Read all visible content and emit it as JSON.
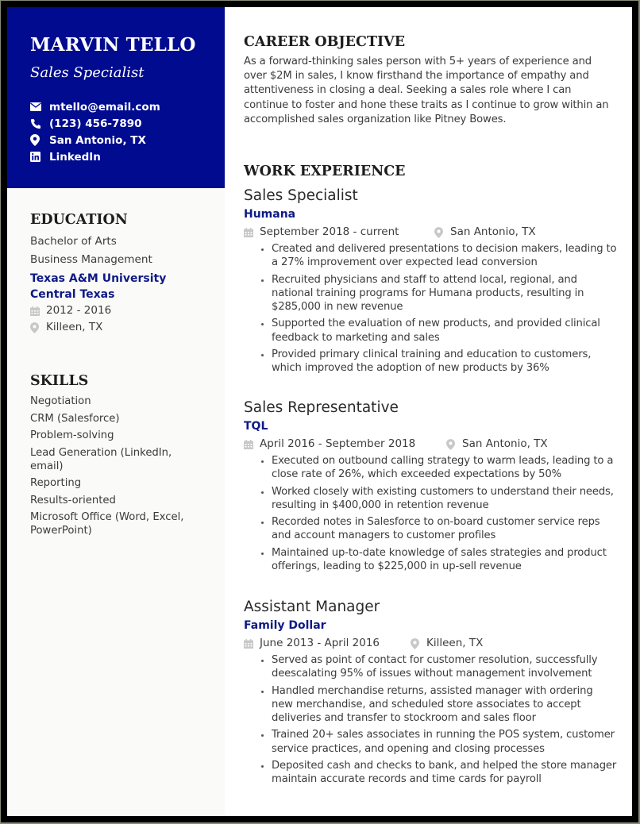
{
  "header": {
    "name": "MARVIN TELLO",
    "role": "Sales Specialist",
    "contacts": [
      {
        "icon": "envelope-icon",
        "text": "mtello@email.com"
      },
      {
        "icon": "phone-icon",
        "text": "(123) 456-7890"
      },
      {
        "icon": "map-pin-icon",
        "text": "San Antonio, TX"
      },
      {
        "icon": "linkedin-icon",
        "text": "LinkedIn"
      }
    ]
  },
  "colors": {
    "accent": "#000b8f",
    "company": "#0e1a86",
    "sidebar_bg": "#fafaf8",
    "icon_gray": "#c8c8c8"
  },
  "education": {
    "title": "EDUCATION",
    "degree": "Bachelor of Arts",
    "major": "Business Management",
    "school_line1": "Texas A&M University",
    "school_line2": "Central Texas",
    "dates": "2012 - 2016",
    "location": "Killeen, TX"
  },
  "skills": {
    "title": "SKILLS",
    "items": [
      "Negotiation",
      "CRM (Salesforce)",
      "Problem-solving",
      "Lead Generation (LinkedIn, email)",
      "Reporting",
      "Results-oriented",
      "Microsoft Office (Word, Excel, PowerPoint)"
    ]
  },
  "objective": {
    "title": "CAREER OBJECTIVE",
    "text": "As a forward-thinking sales person with 5+ years of experience and over $2M in sales, I know firsthand the importance of empathy and attentiveness in closing a deal. Seeking a sales role where I can continue to foster and hone these traits as I continue to grow within an accomplished sales organization like Pitney Bowes."
  },
  "work": {
    "title": "WORK EXPERIENCE",
    "jobs": [
      {
        "title": "Sales Specialist",
        "company": "Humana",
        "dates": "September 2018 - current",
        "location": "San Antonio, TX",
        "bullets": [
          "Created and delivered presentations to decision makers, leading to a 27% improvement over expected lead conversion",
          "Recruited physicians and staff to attend local, regional, and national training programs for Humana products, resulting in $285,000 in new revenue",
          "Supported the evaluation of new products, and provided clinical feedback to marketing and sales",
          "Provided primary clinical training and education to customers, which improved the adoption of new products by 36%"
        ]
      },
      {
        "title": "Sales Representative",
        "company": "TQL",
        "dates": "April 2016 - September 2018",
        "location": "San Antonio, TX",
        "bullets": [
          "Executed on outbound calling strategy to warm leads, leading to a close rate of 26%, which exceeded expectations by 50%",
          "Worked closely with existing customers to understand their needs, resulting in $400,000 in retention revenue",
          "Recorded notes in Salesforce to on-board customer service reps and account managers to customer profiles",
          "Maintained up-to-date knowledge of sales strategies and product offerings, leading to $225,000 in up-sell revenue"
        ]
      },
      {
        "title": "Assistant Manager",
        "company": "Family Dollar",
        "dates": "June 2013 - April 2016",
        "location": "Killeen, TX",
        "bullets": [
          "Served as point of contact for customer resolution, successfully deescalating 95% of issues without management involvement",
          "Handled merchandise returns, assisted manager with ordering new merchandise, and scheduled store associates to accept deliveries and transfer to stockroom and sales floor",
          "Trained 20+ sales associates in running the POS system, customer service practices, and opening and closing processes",
          "Deposited cash and checks to bank, and helped the store manager maintain accurate records and time cards for payroll"
        ]
      }
    ]
  }
}
